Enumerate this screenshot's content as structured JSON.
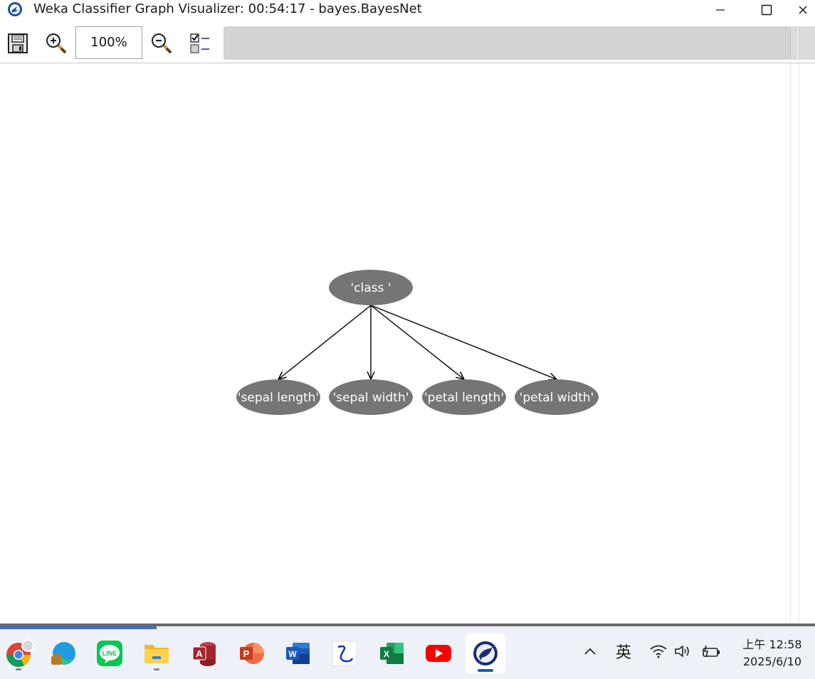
{
  "window": {
    "title": "Weka Classifier Graph Visualizer: 00:54:17 - bayes.BayesNet",
    "controls": {
      "minimize": "—",
      "maximize": "☐",
      "close": "✕"
    }
  },
  "toolbar": {
    "zoom_value": "100%",
    "icons": [
      "save-icon",
      "zoom-in-icon",
      "zoom-out-icon",
      "options-checklist-icon"
    ]
  },
  "graph": {
    "nodes": [
      {
        "id": "class",
        "label": "'class '"
      },
      {
        "id": "sepal_length",
        "label": "'sepal length'"
      },
      {
        "id": "sepal_width",
        "label": "'sepal width'"
      },
      {
        "id": "petal_length",
        "label": "'petal length'"
      },
      {
        "id": "petal_width",
        "label": "'petal width'"
      }
    ],
    "edges": [
      {
        "from": "class",
        "to": "sepal_length"
      },
      {
        "from": "class",
        "to": "sepal_width"
      },
      {
        "from": "class",
        "to": "petal_length"
      },
      {
        "from": "class",
        "to": "petal_width"
      }
    ],
    "node_color": "#757575",
    "label_color": "#ffffff",
    "edge_color": "#000000"
  },
  "taskbar": {
    "apps": [
      {
        "name": "chrome",
        "icon": "chrome-icon"
      },
      {
        "name": "edge",
        "icon": "edge-icon"
      },
      {
        "name": "line",
        "icon": "line-icon",
        "label": "LINE"
      },
      {
        "name": "file-explorer",
        "icon": "folder-icon"
      },
      {
        "name": "access",
        "icon": "access-icon",
        "label": "A"
      },
      {
        "name": "powerpoint",
        "icon": "powerpoint-icon",
        "label": "P"
      },
      {
        "name": "word",
        "icon": "word-icon",
        "label": "W"
      },
      {
        "name": "pen-app",
        "icon": "pen-icon"
      },
      {
        "name": "excel",
        "icon": "excel-icon",
        "label": "X"
      },
      {
        "name": "youtube",
        "icon": "youtube-icon"
      },
      {
        "name": "weka",
        "icon": "weka-bird-icon"
      }
    ],
    "tray": {
      "chevron": "^",
      "ime": "英",
      "time": "上午 12:58",
      "date": "2025/6/10"
    }
  }
}
